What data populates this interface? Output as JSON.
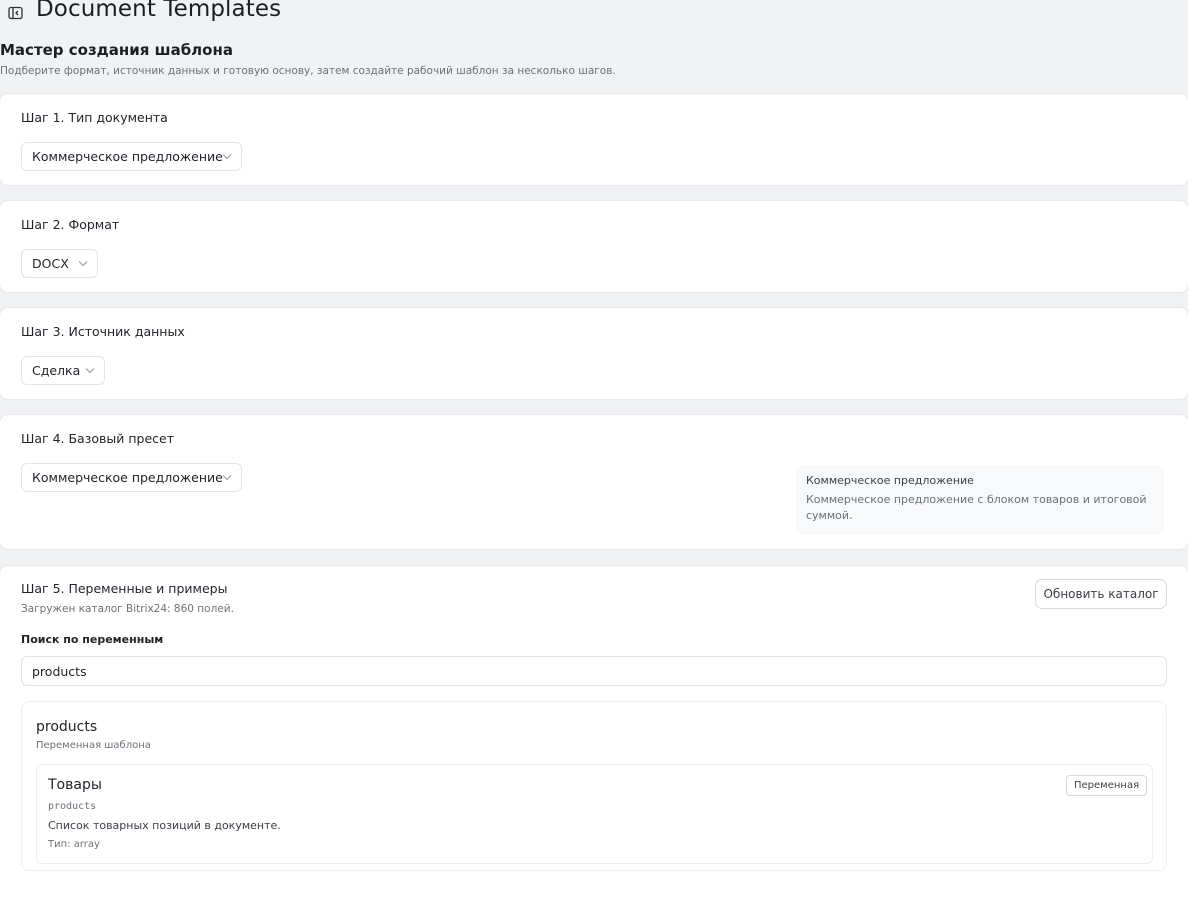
{
  "header": {
    "title": "Document Templates",
    "toggle_icon": "sidebar-toggle-icon"
  },
  "wizard": {
    "title": "Мастер создания шаблона",
    "subtitle": "Подберите формат, источник данных и готовую основу, затем создайте рабочий шаблон за несколько шагов."
  },
  "step1": {
    "title": "Шаг 1. Тип документа",
    "select_value": "Коммерческое предложение"
  },
  "step2": {
    "title": "Шаг 2. Формат",
    "select_value": "DOCX"
  },
  "step3": {
    "title": "Шаг 3. Источник данных",
    "select_value": "Сделка"
  },
  "step4": {
    "title": "Шаг 4. Базовый пресет",
    "select_value": "Коммерческое предложение",
    "preset_info": {
      "title": "Коммерческое предложение",
      "description": "Коммерческое предложение с блоком товаров и итоговой суммой."
    }
  },
  "step5": {
    "title": "Шаг 5. Переменные и примеры",
    "catalog_note": "Загружен каталог Bitrix24: 860 полей.",
    "refresh_button": "Обновить каталог",
    "search_label": "Поиск по переменным",
    "search_value": "products",
    "group": {
      "title": "products",
      "subtitle": "Переменная шаблона",
      "item": {
        "title": "Товары",
        "code": "products",
        "description": "Список товарных позиций в документе.",
        "type": "Тип: array",
        "badge": "Переменная"
      }
    }
  }
}
